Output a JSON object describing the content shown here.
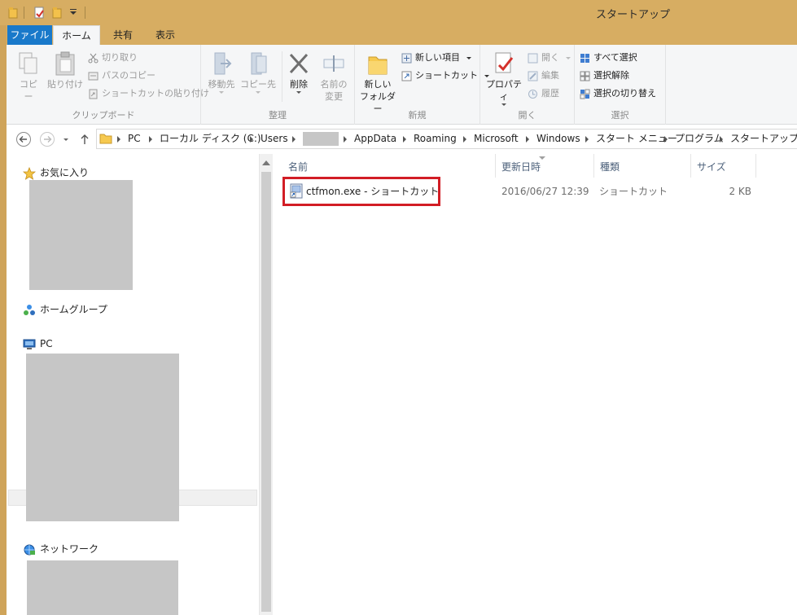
{
  "window": {
    "title": "スタートアップ"
  },
  "ribbon_tabs": [
    {
      "label": "ファイル"
    },
    {
      "label": "ホーム"
    },
    {
      "label": "共有"
    },
    {
      "label": "表示"
    }
  ],
  "ribbon": {
    "clipboard": {
      "copy": "コピー",
      "paste": "貼り付け",
      "cut": "切り取り",
      "copy_path": "パスのコピー",
      "paste_shortcut": "ショートカットの貼り付け",
      "label": "クリップボード"
    },
    "organize": {
      "move_to": "移動先",
      "copy_to": "コピー先",
      "delete": "削除",
      "rename_line1": "名前の",
      "rename_line2": "変更",
      "label": "整理"
    },
    "new": {
      "new_folder_line1": "新しい",
      "new_folder_line2": "フォルダー",
      "new_item": "新しい項目",
      "shortcut": "ショートカット",
      "label": "新規"
    },
    "open": {
      "properties": "プロパティ",
      "open": "開く",
      "edit": "編集",
      "history": "履歴",
      "label": "開く"
    },
    "select": {
      "select_all": "すべて選択",
      "select_none": "選択解除",
      "invert": "選択の切り替え",
      "label": "選択"
    }
  },
  "address": {
    "crumbs": [
      "PC",
      "ローカル ディスク (C:)",
      "Users",
      "AppData",
      "Roaming",
      "Microsoft",
      "Windows",
      "スタート メニュー",
      "プログラム",
      "スタートアップ"
    ]
  },
  "nav_pane": {
    "favorites": "お気に入り",
    "homegroup": "ホームグループ",
    "pc": "PC",
    "network": "ネットワーク"
  },
  "file_list": {
    "columns": [
      "名前",
      "更新日時",
      "種類",
      "サイズ"
    ],
    "rows": [
      {
        "name": "ctfmon.exe - ショートカット",
        "modified": "2016/06/27 12:39",
        "type": "ショートカット",
        "size": "2 KB"
      }
    ]
  },
  "colors": {
    "frame": "#d7ad62",
    "file_tab": "#1979ca",
    "highlight_box": "#d21d25",
    "redaction": "#c6c6c6"
  }
}
